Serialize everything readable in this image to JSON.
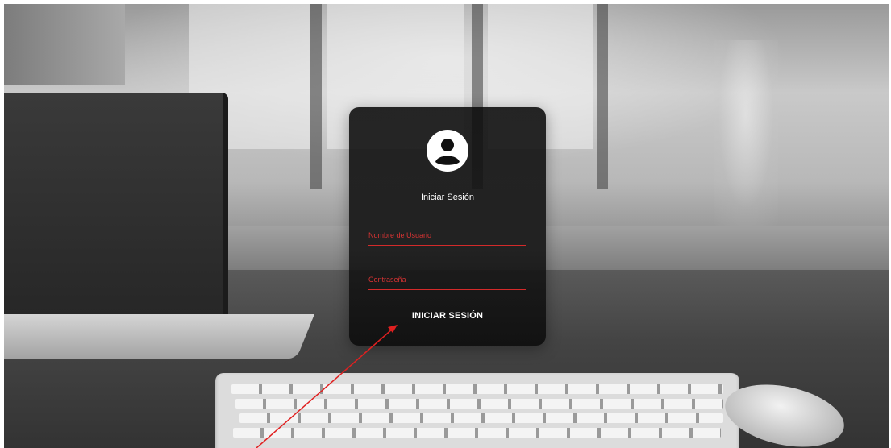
{
  "login": {
    "title": "Iniciar Sesión",
    "username": {
      "placeholder": "Nombre de Usuario",
      "value": ""
    },
    "password": {
      "placeholder": "Contraseña",
      "value": ""
    },
    "submit_label": "INICIAR SESIÓN",
    "avatar_icon": "user-circle-icon",
    "accent_color": "#d42a2a"
  },
  "annotation": {
    "type": "arrow",
    "color": "#e02020",
    "target": "login-button"
  }
}
